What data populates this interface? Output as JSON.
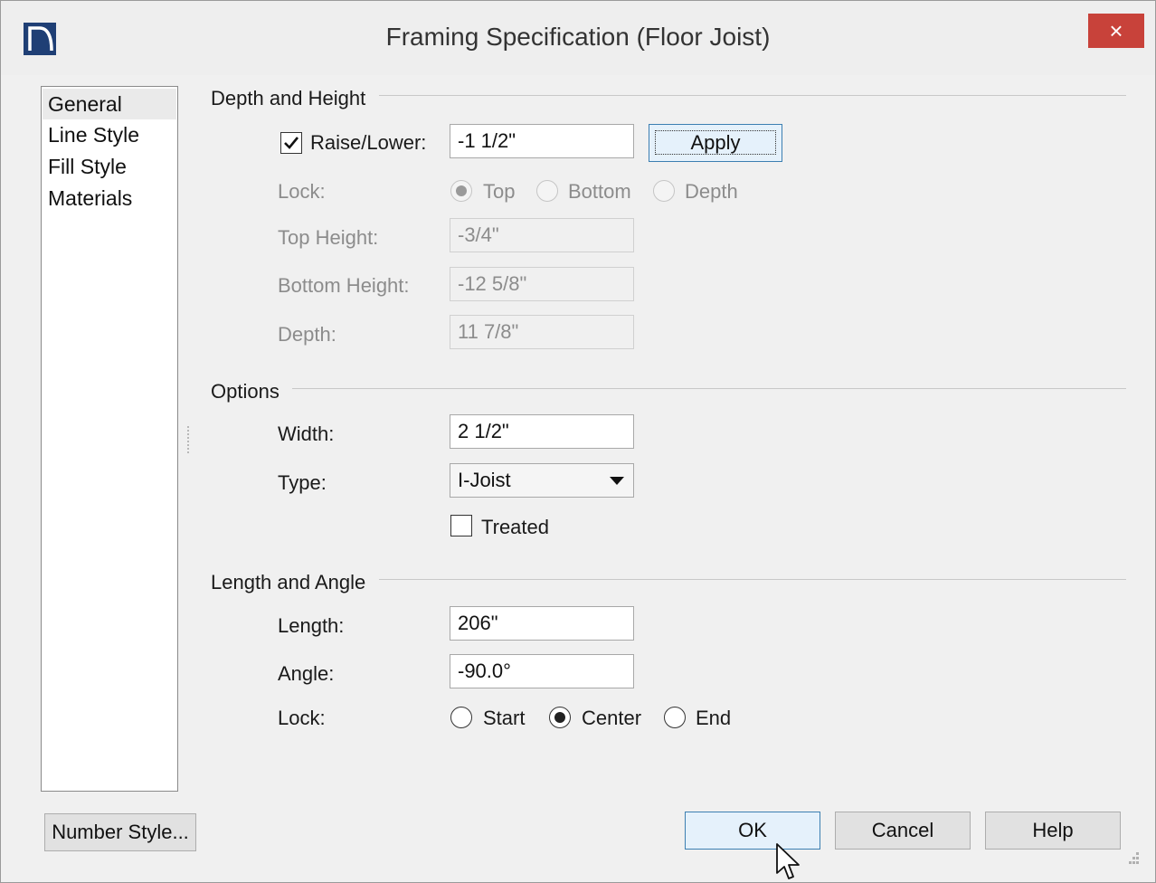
{
  "window": {
    "title": "Framing Specification (Floor Joist)",
    "close_label": "×"
  },
  "sidebar": {
    "items": [
      {
        "label": "General"
      },
      {
        "label": "Line Style"
      },
      {
        "label": "Fill Style"
      },
      {
        "label": "Materials"
      }
    ]
  },
  "depth_height": {
    "title": "Depth and Height",
    "raise_lower": {
      "checked": true,
      "label": "Raise/Lower:",
      "value": "-1 1/2\""
    },
    "apply_label": "Apply",
    "lock": {
      "label": "Lock:",
      "options": [
        "Top",
        "Bottom",
        "Depth"
      ],
      "selected": "Top"
    },
    "top_height": {
      "label": "Top Height:",
      "value": "-3/4\""
    },
    "bottom_height": {
      "label": "Bottom Height:",
      "value": "-12 5/8\""
    },
    "depth": {
      "label": "Depth:",
      "value": "11 7/8\""
    }
  },
  "options": {
    "title": "Options",
    "width": {
      "label": "Width:",
      "value": "2 1/2\""
    },
    "type": {
      "label": "Type:",
      "value": "I-Joist"
    },
    "treated": {
      "label": "Treated",
      "checked": false
    }
  },
  "length_angle": {
    "title": "Length and Angle",
    "length": {
      "label": "Length:",
      "value": "206\""
    },
    "angle": {
      "label": "Angle:",
      "value": "-90.0°"
    },
    "lock": {
      "label": "Lock:",
      "options": [
        "Start",
        "Center",
        "End"
      ],
      "selected": "Center"
    }
  },
  "footer": {
    "number_style_label": "Number Style...",
    "ok_label": "OK",
    "cancel_label": "Cancel",
    "help_label": "Help"
  },
  "colors": {
    "close_bg": "#c8423a",
    "default_button_border": "#3c7fb1",
    "app_icon": "#1f3f75"
  },
  "icons": [
    "app-icon",
    "close-icon",
    "checkmark-icon",
    "dropdown-arrow-icon",
    "mouse-cursor-icon",
    "resize-grip-icon"
  ]
}
